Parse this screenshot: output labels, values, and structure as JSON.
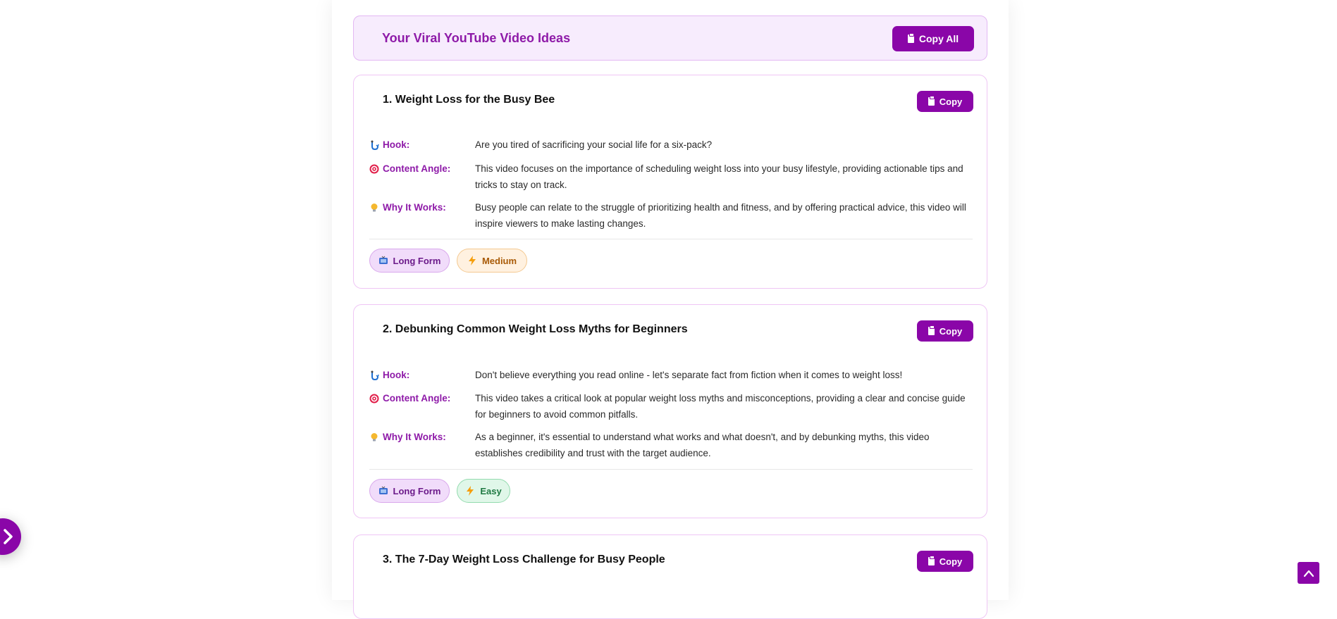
{
  "results": {
    "title": "Your Viral YouTube Video Ideas",
    "copy_all_label": "Copy All"
  },
  "ideas": [
    {
      "title": "1. Weight Loss for the Busy Bee",
      "copy_label": "Copy",
      "hook_label": "Hook:",
      "hook": "Are you tired of sacrificing your social life for a six-pack?",
      "angle_label": "Content Angle:",
      "angle": "This video focuses on the importance of scheduling weight loss into your busy lifestyle, providing actionable tips and tricks to stay on track.",
      "why_label": "Why It Works:",
      "why": "Busy people can relate to the struggle of prioritizing health and fitness, and by offering practical advice, this video will inspire viewers to make lasting changes.",
      "format_tag": "Long Form",
      "difficulty_tag": "Medium"
    },
    {
      "title": "2. Debunking Common Weight Loss Myths for Beginners",
      "copy_label": "Copy",
      "hook_label": "Hook:",
      "hook": "Don't believe everything you read online - let's separate fact from fiction when it comes to weight loss!",
      "angle_label": "Content Angle:",
      "angle": "This video takes a critical look at popular weight loss myths and misconceptions, providing a clear and concise guide for beginners to avoid common pitfalls.",
      "why_label": "Why It Works:",
      "why": "As a beginner, it's essential to understand what works and what doesn't, and by debunking myths, this video establishes credibility and trust with the target audience.",
      "format_tag": "Long Form",
      "difficulty_tag": "Easy"
    },
    {
      "title": "3. The 7-Day Weight Loss Challenge for Busy People",
      "copy_label": "Copy"
    }
  ],
  "colors": {
    "accent": "#8a06a8",
    "accent_text": "#8e1aa8",
    "header_bg": "#f7ecfd"
  },
  "icons": {
    "hook": "fishing-hook-icon",
    "angle": "target-icon",
    "why": "lightbulb-icon",
    "format": "tv-icon",
    "difficulty": "lightning-icon"
  }
}
